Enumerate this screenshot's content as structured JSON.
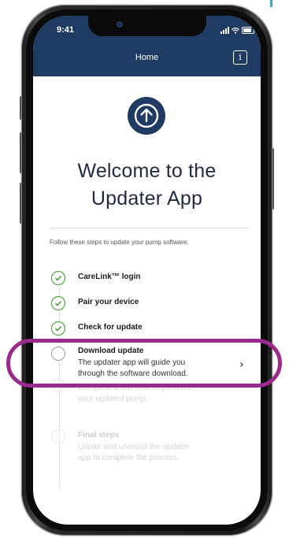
{
  "status_bar": {
    "time": "9:41"
  },
  "header": {
    "title": "Home",
    "info_glyph": "i"
  },
  "welcome": {
    "line1": "Welcome to the",
    "line2": "Updater App"
  },
  "instruction": "Follow these steps to update your pump software.",
  "steps": [
    {
      "title": "CareLink™ login",
      "status": "complete"
    },
    {
      "title": "Pair your device",
      "status": "complete"
    },
    {
      "title": "Check for update",
      "status": "complete"
    },
    {
      "title": "Download update",
      "desc_line1": "The updater app will guide you",
      "desc_line2": "through the software download.",
      "status": "current"
    },
    {
      "desc_line1": "Complete a few final steps to use",
      "desc_line2": "your updated pump.",
      "status": "upcoming"
    },
    {
      "title": "Final steps",
      "desc_line1": "Unpair and uninstall the updater",
      "desc_line2": "app to complete the process.",
      "status": "upcoming"
    }
  ],
  "icons": {
    "upload": "upload-arrow-icon",
    "info": "info-icon",
    "check": "check-icon",
    "chevron": "chevron-right-icon",
    "signal": "signal-icon",
    "wifi": "wifi-icon",
    "battery": "battery-icon"
  },
  "colors": {
    "header_bg": "#1f3a63",
    "check_green": "#3b9a2e",
    "highlight": "#9b2a8e",
    "title_text": "#1f2a44"
  }
}
